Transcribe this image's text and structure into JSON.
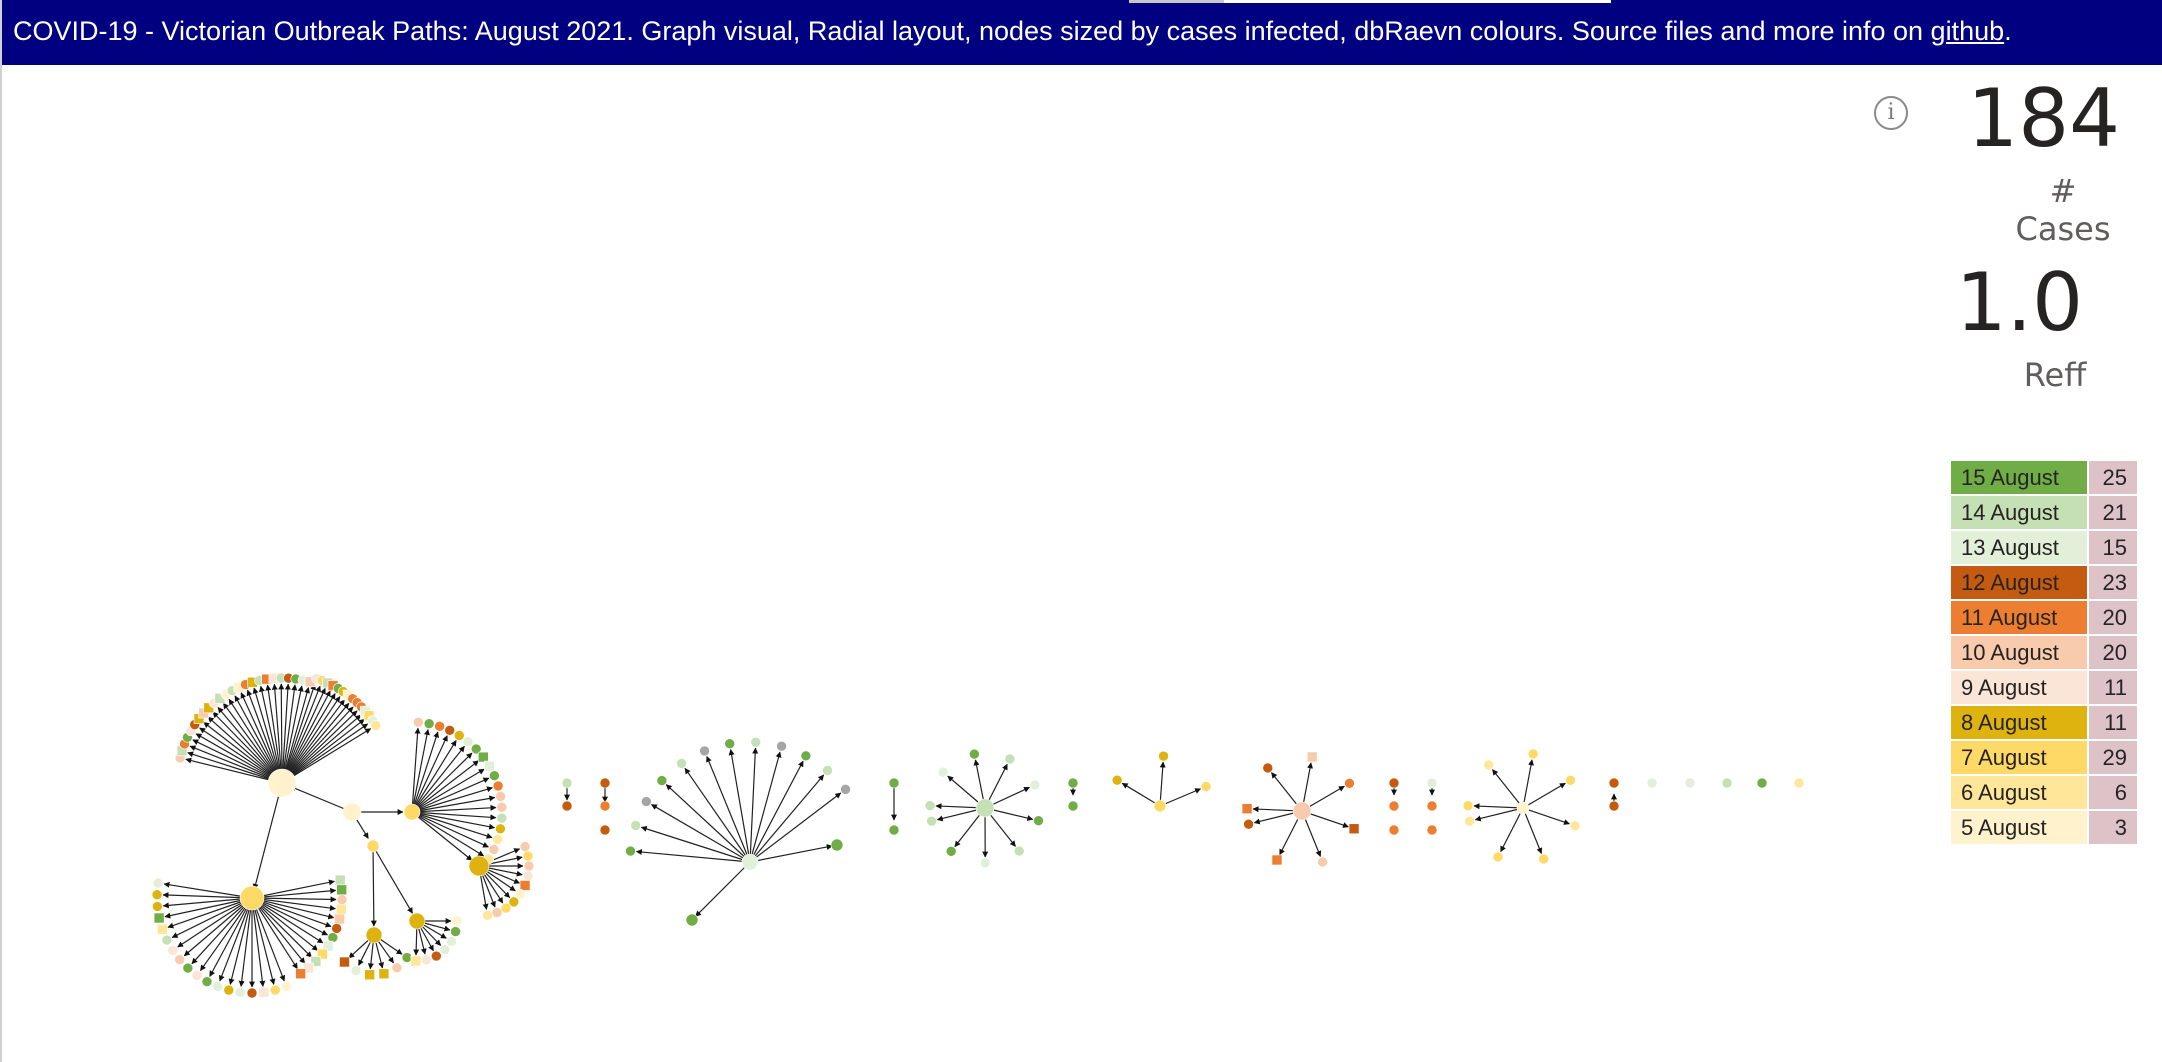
{
  "header": {
    "title": "COVID-19  - Victorian Outbreak Paths: August 2021.  Graph visual, Radial layout, nodes sized by cases infected, dbRaevn colours. Source files and more info on ",
    "link_label": "github",
    "title_end": ".",
    "background": "#000080"
  },
  "info_icon": "info-icon",
  "kpis": {
    "cases_value": "184",
    "cases_label": "# Cases",
    "reff_value": "1.0",
    "reff_label": "Reff"
  },
  "date_legend": [
    {
      "date": "15 August",
      "count": "25",
      "color": "#70ad47"
    },
    {
      "date": "14 August",
      "count": "21",
      "color": "#c5e0b4"
    },
    {
      "date": "13 August",
      "count": "15",
      "color": "#e2f0d9"
    },
    {
      "date": "12 August",
      "count": "23",
      "color": "#c55a11"
    },
    {
      "date": "11 August",
      "count": "20",
      "color": "#ed7d31"
    },
    {
      "date": "10 August",
      "count": "20",
      "color": "#f8cbad"
    },
    {
      "date": "9 August",
      "count": "11",
      "color": "#fbe5d6"
    },
    {
      "date": "8 August",
      "count": "11",
      "color": "#deb20f"
    },
    {
      "date": "7 August",
      "count": "29",
      "color": "#ffd966"
    },
    {
      "date": "6 August",
      "count": "6",
      "color": "#ffe699"
    },
    {
      "date": "5 August",
      "count": "3",
      "color": "#fff2cc"
    }
  ]
}
